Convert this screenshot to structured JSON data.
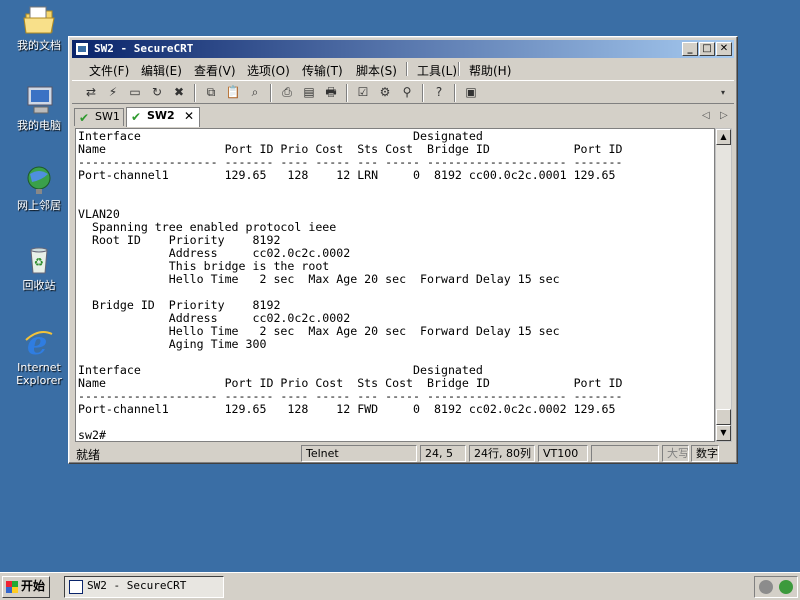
{
  "desktop": {
    "icons": [
      {
        "label": "我的文档"
      },
      {
        "label": "我的电脑"
      },
      {
        "label": "网上邻居"
      },
      {
        "label": "回收站"
      },
      {
        "label": "Internet Explorer"
      }
    ]
  },
  "window": {
    "title": "SW2 - SecureCRT",
    "menu": [
      "文件(F)",
      "编辑(E)",
      "查看(V)",
      "选项(O)",
      "传输(T)",
      "脚本(S)",
      "工具(L)",
      "帮助(H)"
    ],
    "tabs": [
      {
        "label": "SW1",
        "active": false
      },
      {
        "label": "SW2",
        "active": true
      }
    ],
    "terminal_lines": [
      "Interface                                       Designated",
      "Name                 Port ID Prio Cost  Sts Cost  Bridge ID            Port ID",
      "-------------------- ------- ---- ----- --- ----- -------------------- -------",
      "Port-channel1        129.65   128    12 LRN     0  8192 cc00.0c2c.0001 129.65",
      "",
      "",
      "VLAN20",
      "  Spanning tree enabled protocol ieee",
      "  Root ID    Priority    8192",
      "             Address     cc02.0c2c.0002",
      "             This bridge is the root",
      "             Hello Time   2 sec  Max Age 20 sec  Forward Delay 15 sec",
      "",
      "  Bridge ID  Priority    8192",
      "             Address     cc02.0c2c.0002",
      "             Hello Time   2 sec  Max Age 20 sec  Forward Delay 15 sec",
      "             Aging Time 300",
      "",
      "Interface                                       Designated",
      "Name                 Port ID Prio Cost  Sts Cost  Bridge ID            Port ID",
      "-------------------- ------- ---- ----- --- ----- -------------------- -------",
      "Port-channel1        129.65   128    12 FWD     0  8192 cc02.0c2c.0002 129.65",
      "",
      "sw2#"
    ],
    "status": {
      "ready": "就绪",
      "protocol": "Telnet",
      "cursor": "24,  5",
      "size": "24行, 80列",
      "emulation": "VT100",
      "caps": "大写",
      "num": "数字"
    }
  },
  "taskbar": {
    "start_label": "开始",
    "task_label": "SW2 - SecureCRT"
  }
}
